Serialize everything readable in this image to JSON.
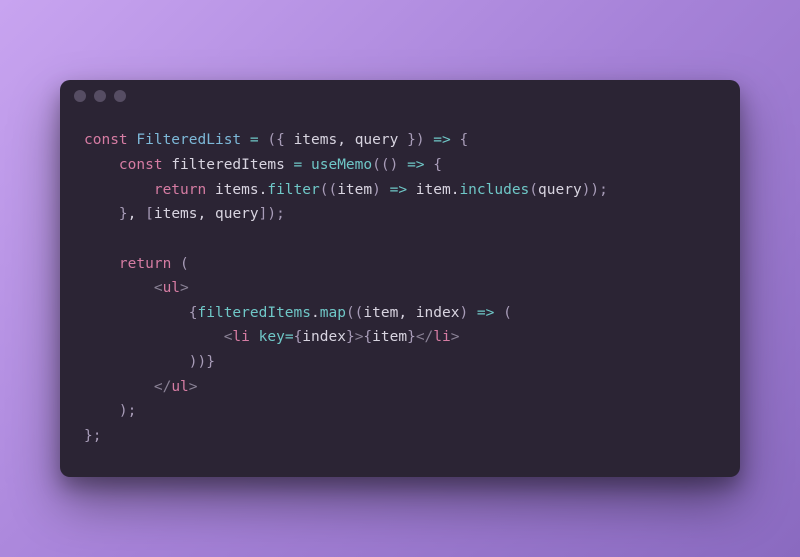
{
  "code": {
    "lines": [
      [
        {
          "t": "const ",
          "c": "kw"
        },
        {
          "t": "FilteredList",
          "c": "fn"
        },
        {
          "t": " ",
          "c": "punct"
        },
        {
          "t": "=",
          "c": "op"
        },
        {
          "t": " ",
          "c": "punct"
        },
        {
          "t": "(",
          "c": "brace"
        },
        {
          "t": "{ ",
          "c": "brace"
        },
        {
          "t": "items",
          "c": "var"
        },
        {
          "t": ", ",
          "c": "punct"
        },
        {
          "t": "query",
          "c": "var"
        },
        {
          "t": " }",
          "c": "brace"
        },
        {
          "t": ")",
          "c": "brace"
        },
        {
          "t": " ",
          "c": "punct"
        },
        {
          "t": "=>",
          "c": "op"
        },
        {
          "t": " ",
          "c": "punct"
        },
        {
          "t": "{",
          "c": "brace"
        }
      ],
      [
        {
          "t": "    ",
          "c": "punct"
        },
        {
          "t": "const ",
          "c": "kw"
        },
        {
          "t": "filteredItems",
          "c": "var"
        },
        {
          "t": " ",
          "c": "punct"
        },
        {
          "t": "=",
          "c": "op"
        },
        {
          "t": " ",
          "c": "punct"
        },
        {
          "t": "useMemo",
          "c": "call"
        },
        {
          "t": "(",
          "c": "brace"
        },
        {
          "t": "()",
          "c": "brace"
        },
        {
          "t": " ",
          "c": "punct"
        },
        {
          "t": "=>",
          "c": "op"
        },
        {
          "t": " ",
          "c": "punct"
        },
        {
          "t": "{",
          "c": "brace"
        }
      ],
      [
        {
          "t": "        ",
          "c": "punct"
        },
        {
          "t": "return ",
          "c": "kw"
        },
        {
          "t": "items",
          "c": "var"
        },
        {
          "t": ".",
          "c": "punct"
        },
        {
          "t": "filter",
          "c": "call"
        },
        {
          "t": "((",
          "c": "brace"
        },
        {
          "t": "item",
          "c": "var"
        },
        {
          "t": ")",
          "c": "brace"
        },
        {
          "t": " ",
          "c": "punct"
        },
        {
          "t": "=>",
          "c": "op"
        },
        {
          "t": " ",
          "c": "punct"
        },
        {
          "t": "item",
          "c": "var"
        },
        {
          "t": ".",
          "c": "punct"
        },
        {
          "t": "includes",
          "c": "call"
        },
        {
          "t": "(",
          "c": "brace"
        },
        {
          "t": "query",
          "c": "var"
        },
        {
          "t": "));",
          "c": "brace"
        }
      ],
      [
        {
          "t": "    ",
          "c": "punct"
        },
        {
          "t": "}",
          "c": "brace"
        },
        {
          "t": ", ",
          "c": "punct"
        },
        {
          "t": "[",
          "c": "brace"
        },
        {
          "t": "items",
          "c": "var"
        },
        {
          "t": ", ",
          "c": "punct"
        },
        {
          "t": "query",
          "c": "var"
        },
        {
          "t": "]);",
          "c": "brace"
        }
      ],
      [
        {
          "t": " ",
          "c": "punct"
        }
      ],
      [
        {
          "t": "    ",
          "c": "punct"
        },
        {
          "t": "return ",
          "c": "kw"
        },
        {
          "t": "(",
          "c": "brace"
        }
      ],
      [
        {
          "t": "        ",
          "c": "punct"
        },
        {
          "t": "<",
          "c": "angle"
        },
        {
          "t": "ul",
          "c": "tag"
        },
        {
          "t": ">",
          "c": "angle"
        }
      ],
      [
        {
          "t": "            ",
          "c": "punct"
        },
        {
          "t": "{",
          "c": "brace"
        },
        {
          "t": "filteredItems",
          "c": "call"
        },
        {
          "t": ".",
          "c": "punct"
        },
        {
          "t": "map",
          "c": "call"
        },
        {
          "t": "((",
          "c": "brace"
        },
        {
          "t": "item",
          "c": "var"
        },
        {
          "t": ", ",
          "c": "punct"
        },
        {
          "t": "index",
          "c": "var"
        },
        {
          "t": ")",
          "c": "brace"
        },
        {
          "t": " ",
          "c": "punct"
        },
        {
          "t": "=>",
          "c": "op"
        },
        {
          "t": " ",
          "c": "punct"
        },
        {
          "t": "(",
          "c": "brace"
        }
      ],
      [
        {
          "t": "                ",
          "c": "punct"
        },
        {
          "t": "<",
          "c": "angle"
        },
        {
          "t": "li",
          "c": "tag"
        },
        {
          "t": " ",
          "c": "punct"
        },
        {
          "t": "key",
          "c": "attr"
        },
        {
          "t": "=",
          "c": "op"
        },
        {
          "t": "{",
          "c": "brace"
        },
        {
          "t": "index",
          "c": "var"
        },
        {
          "t": "}",
          "c": "brace"
        },
        {
          "t": ">",
          "c": "angle"
        },
        {
          "t": "{",
          "c": "brace"
        },
        {
          "t": "item",
          "c": "var"
        },
        {
          "t": "}",
          "c": "brace"
        },
        {
          "t": "</",
          "c": "angle"
        },
        {
          "t": "li",
          "c": "tag"
        },
        {
          "t": ">",
          "c": "angle"
        }
      ],
      [
        {
          "t": "            ",
          "c": "punct"
        },
        {
          "t": "))",
          "c": "brace"
        },
        {
          "t": "}",
          "c": "brace"
        }
      ],
      [
        {
          "t": "        ",
          "c": "punct"
        },
        {
          "t": "</",
          "c": "angle"
        },
        {
          "t": "ul",
          "c": "tag"
        },
        {
          "t": ">",
          "c": "angle"
        }
      ],
      [
        {
          "t": "    ",
          "c": "punct"
        },
        {
          "t": ");",
          "c": "brace"
        }
      ],
      [
        {
          "t": "};",
          "c": "brace"
        }
      ]
    ]
  }
}
